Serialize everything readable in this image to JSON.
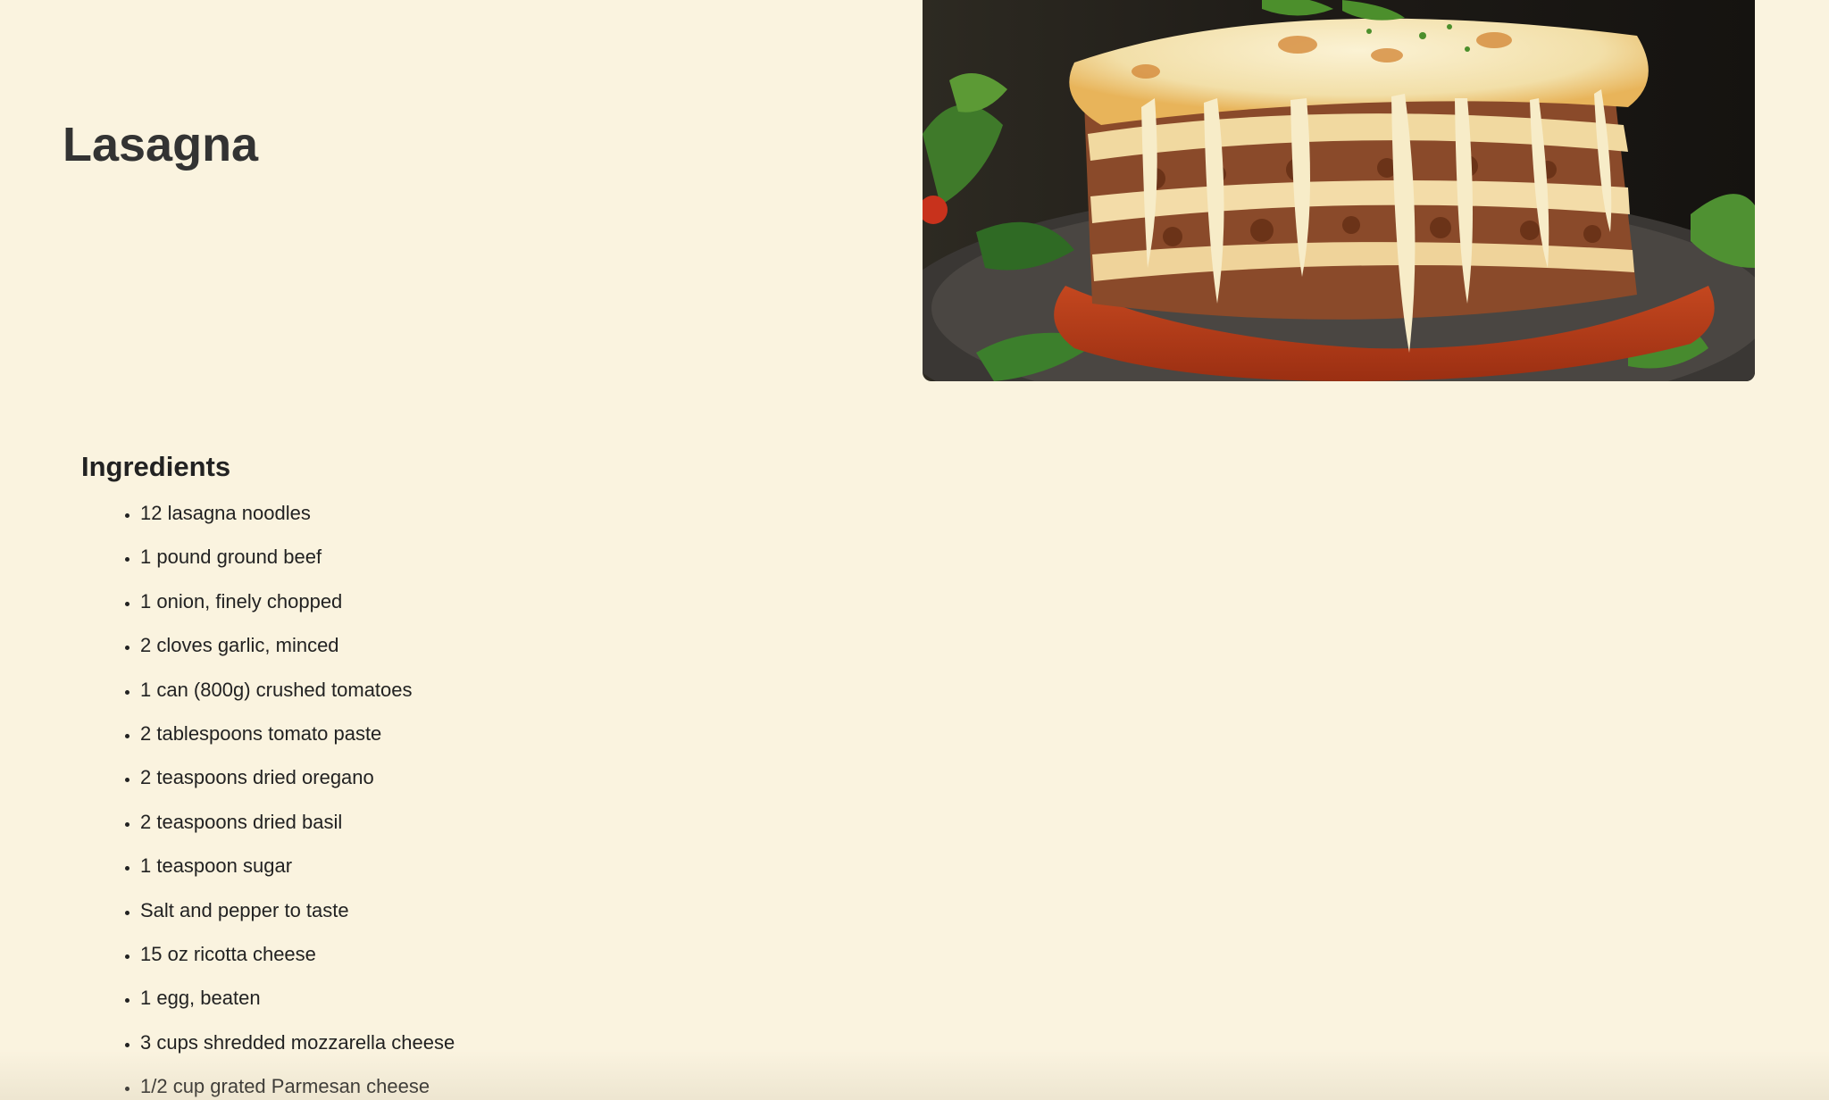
{
  "recipe": {
    "title": "Lasagna",
    "image_icon": "lasagna-photo",
    "ingredients_heading": "Ingredients",
    "ingredients": [
      "12 lasagna noodles",
      "1 pound ground beef",
      "1 onion, finely chopped",
      "2 cloves garlic, minced",
      "1 can (800g) crushed tomatoes",
      "2 tablespoons tomato paste",
      "2 teaspoons dried oregano",
      "2 teaspoons dried basil",
      "1 teaspoon sugar",
      "Salt and pepper to taste",
      "15 oz ricotta cheese",
      "1 egg, beaten",
      "3 cups shredded mozzarella cheese",
      "1/2 cup grated Parmesan cheese"
    ]
  },
  "colors": {
    "background": "#faf3df",
    "title_text": "#333333",
    "body_text": "#222222"
  }
}
